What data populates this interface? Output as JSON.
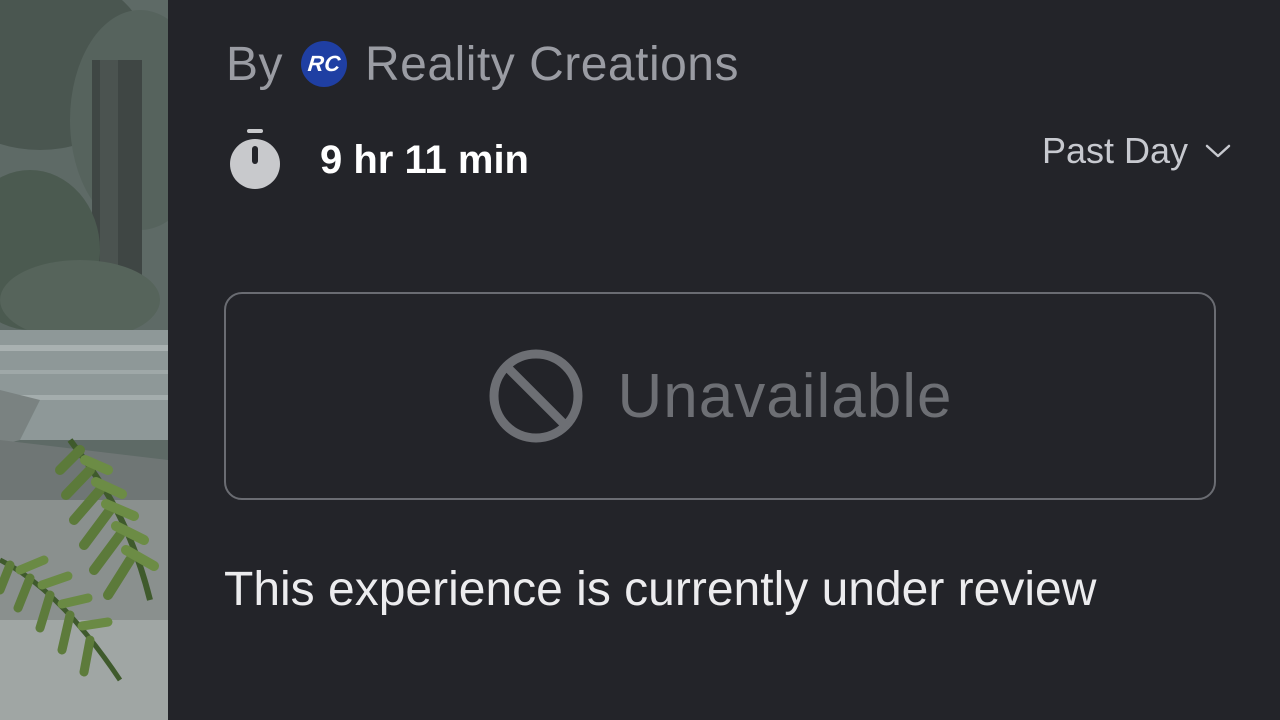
{
  "creator": {
    "prefix": "By",
    "logo_text": "RC",
    "name": "Reality Creations"
  },
  "playtime": {
    "icon": "stopwatch-icon",
    "value": "9 hr 11 min"
  },
  "time_range": {
    "selected": "Past Day",
    "icon": "chevron-down-icon"
  },
  "play_button": {
    "icon": "ban-icon",
    "label": "Unavailable",
    "disabled": true
  },
  "status_message": "This experience is currently under review",
  "colors": {
    "background": "#232429",
    "creator_logo": "#1f3fa3",
    "muted_text": "#9a9ca3",
    "disabled": "#6d6f74"
  }
}
